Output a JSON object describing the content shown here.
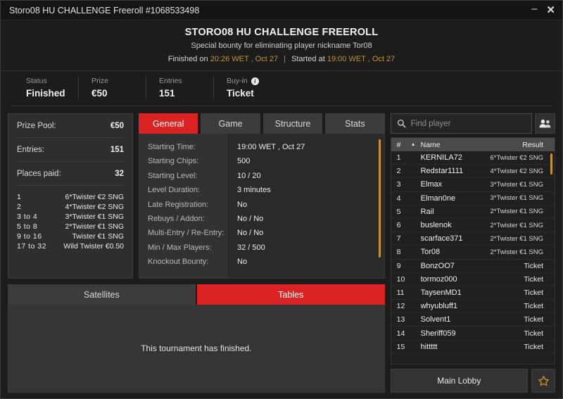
{
  "window": {
    "title": "Storo08 HU CHALLENGE Freeroll #1068533498",
    "minimize_label": "–",
    "close_label": "✕"
  },
  "header": {
    "title": "STORO08 HU CHALLENGE FREEROLL",
    "subtitle": "Special bounty for eliminating player nickname Tor08",
    "finished_prefix": "Finished on",
    "finished_time": "20:26 WET , Oct 27",
    "separator": "|",
    "started_prefix": "Started at",
    "started_time": "19:00 WET , Oct 27"
  },
  "status_strip": [
    {
      "label": "Status",
      "value": "Finished",
      "info": false
    },
    {
      "label": "Prize",
      "value": "€50",
      "info": false
    },
    {
      "label": "Entries",
      "value": "151",
      "info": false
    },
    {
      "label": "Buy-in",
      "value": "Ticket",
      "info": true
    }
  ],
  "prize_panel": {
    "rows": [
      {
        "label": "Prize Pool:",
        "value": "€50"
      },
      {
        "label": "Entries:",
        "value": "151"
      },
      {
        "label": "Places paid:",
        "value": "32"
      }
    ],
    "payouts": [
      {
        "place": "1",
        "prize": "6*Twister €2 SNG"
      },
      {
        "place": "2",
        "prize": "4*Twister €2 SNG"
      },
      {
        "place": "3  to  4",
        "prize": "3*Twister €1 SNG"
      },
      {
        "place": "5  to  8",
        "prize": "2*Twister €1 SNG"
      },
      {
        "place": "9  to  16",
        "prize": "Twister €1 SNG"
      },
      {
        "place": "17  to  32",
        "prize": "Wild Twister €0.50"
      }
    ]
  },
  "tabs": [
    {
      "label": "General",
      "active": true
    },
    {
      "label": "Game",
      "active": false
    },
    {
      "label": "Structure",
      "active": false
    },
    {
      "label": "Stats",
      "active": false
    }
  ],
  "general_details": [
    {
      "label": "Starting Time:",
      "value": "19:00 WET , Oct 27"
    },
    {
      "label": "Starting Chips:",
      "value": "500"
    },
    {
      "label": "Starting Level:",
      "value": "10 / 20"
    },
    {
      "label": "Level Duration:",
      "value": "3 minutes"
    },
    {
      "label": "Late Registration:",
      "value": "No"
    },
    {
      "label": "Rebuys / Addon:",
      "value": "No / No"
    },
    {
      "label": "Multi-Entry / Re-Entry:",
      "value": "No / No"
    },
    {
      "label": "Min / Max Players:",
      "value": "32 / 500"
    },
    {
      "label": "Knockout Bounty:",
      "value": "No"
    }
  ],
  "sub_tabs": [
    {
      "label": "Satellites",
      "active": false
    },
    {
      "label": "Tables",
      "active": true
    }
  ],
  "lower_panel": {
    "message": "This tournament has finished."
  },
  "search": {
    "placeholder": "Find player",
    "value": "",
    "icon": "search-icon",
    "people_icon": "people-icon"
  },
  "player_list": {
    "columns": {
      "num": "#",
      "sort": "▲",
      "name": "Name",
      "result": "Result"
    },
    "rows": [
      {
        "num": "1",
        "name": "KERNILA72",
        "result": "6*Twister €2 SNG",
        "ticket": false
      },
      {
        "num": "2",
        "name": "Redstar1111",
        "result": "4*Twister €2 SNG",
        "ticket": false
      },
      {
        "num": "3",
        "name": "Elmax",
        "result": "3*Twister €1 SNG",
        "ticket": false
      },
      {
        "num": "4",
        "name": "Elman0ne",
        "result": "3*Twister €1 SNG",
        "ticket": false
      },
      {
        "num": "5",
        "name": "Rail",
        "result": "2*Twister €1 SNG",
        "ticket": false
      },
      {
        "num": "6",
        "name": "buslenok",
        "result": "2*Twister €1 SNG",
        "ticket": false
      },
      {
        "num": "7",
        "name": "scarface371",
        "result": "2*Twister €1 SNG",
        "ticket": false
      },
      {
        "num": "8",
        "name": "Tor08",
        "result": "2*Twister €1 SNG",
        "ticket": false
      },
      {
        "num": "9",
        "name": "BonzOO7",
        "result": "Ticket",
        "ticket": true
      },
      {
        "num": "10",
        "name": "tormoz000",
        "result": "Ticket",
        "ticket": true
      },
      {
        "num": "11",
        "name": "TaysenMD1",
        "result": "Ticket",
        "ticket": true
      },
      {
        "num": "12",
        "name": "whyubluff1",
        "result": "Ticket",
        "ticket": true
      },
      {
        "num": "13",
        "name": "Solvent1",
        "result": "Ticket",
        "ticket": true
      },
      {
        "num": "14",
        "name": "Sheriff059",
        "result": "Ticket",
        "ticket": true
      },
      {
        "num": "15",
        "name": "hittttt",
        "result": "Ticket",
        "ticket": true
      }
    ]
  },
  "footer": {
    "main_lobby_label": "Main Lobby",
    "favorite_icon": "star-icon"
  },
  "colors": {
    "accent_red": "#dc2323",
    "amber": "#c8922c",
    "window_bg": "#1c1c1c",
    "panel_bg": "#2e2e2e"
  }
}
